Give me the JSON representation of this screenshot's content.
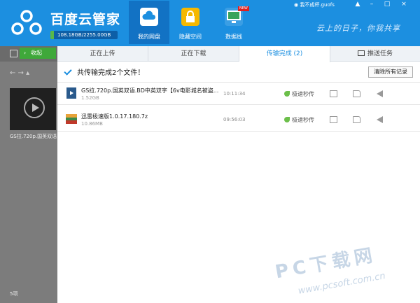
{
  "header": {
    "app_title": "百度云管家",
    "quota_text": "108.18GB/2255.00GB",
    "quota_used_fraction": 0.048,
    "username": "我不成杯.guofs",
    "slogan": "云上的日子，你我共享",
    "nav": [
      {
        "label": "我的网盘",
        "icon": "cloud-drive-icon",
        "active": true
      },
      {
        "label": "隐藏空间",
        "icon": "lock-icon",
        "active": false
      },
      {
        "label": "数据线",
        "icon": "data-cable-icon",
        "active": false,
        "badge": "NEW"
      }
    ],
    "window_controls": [
      "▲",
      "–",
      "□",
      "×"
    ]
  },
  "left": {
    "collapse_label": "收起",
    "nav_arrows": "←  →  ▴",
    "thumb_name": "GS拉.720p.国英双语",
    "item_count": "5项"
  },
  "tabs": [
    {
      "label": "正在上传",
      "active": false
    },
    {
      "label": "正在下载",
      "active": false
    },
    {
      "label": "传输完成 (2)",
      "active": true
    },
    {
      "label": "推送任务",
      "active": false,
      "icon": "push-icon"
    }
  ],
  "summary": "共传输完成2个文件！",
  "clear_label": "清除所有记录",
  "files": [
    {
      "name": "GS拉.720p.国英双语.BD中英双字【6v电影城名被盗...",
      "size": "1.52GB",
      "time": "10:11:34",
      "tag": "极速秒传",
      "icon": "video-file-icon"
    },
    {
      "name": "迅雷极速版1.0.17.180.7z",
      "size": "10.86MB",
      "time": "09:56:03",
      "tag": "极速秒传",
      "icon": "archive-file-icon"
    }
  ],
  "watermark": {
    "text": "PC下载网",
    "url": "www.pcsoft.com.cn"
  },
  "colors": {
    "header_blue": "#1c8fe0",
    "active_tab_blue": "#1c8fe0",
    "green": "#3fa83a"
  }
}
